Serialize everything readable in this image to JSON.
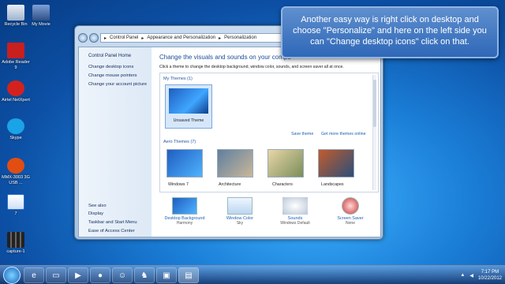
{
  "desktop": {
    "icons": [
      {
        "label": "Recycle Bin",
        "icon": "recycle-bin-icon",
        "color": "#c9d6e6"
      },
      {
        "label": "My Movie",
        "icon": "movie-icon",
        "color": "#4a6fa8"
      },
      {
        "label": "Adobe Reader 9",
        "icon": "adobe-reader-icon",
        "color": "#c81f1f"
      },
      {
        "label": "Airtel NetXpert",
        "icon": "airtel-icon",
        "color": "#d3221e"
      },
      {
        "label": "Skype",
        "icon": "skype-icon",
        "color": "#1aa3e6"
      },
      {
        "label": "MMX-3003 3G USB ...",
        "icon": "mmx-icon",
        "color": "#e24d12"
      },
      {
        "label": "7",
        "icon": "document-icon",
        "color": "#2d6bd0"
      },
      {
        "label": "capture-1",
        "icon": "capture-icon",
        "color": "#2a2a2a"
      }
    ]
  },
  "window": {
    "breadcrumb": [
      "Control Panel",
      "Appearance and Personalization",
      "Personalization"
    ],
    "leftnav": {
      "home": "Control Panel Home",
      "links": [
        "Change desktop icons",
        "Change mouse pointers",
        "Change your account picture"
      ],
      "see_also_title": "See also",
      "see_also": [
        "Display",
        "Taskbar and Start Menu",
        "Ease of Access Center"
      ]
    },
    "heading": "Change the visuals and sounds on your compu",
    "description": "Click a theme to change the desktop background, window color, sounds, and screen saver all at once.",
    "my_themes": {
      "title": "My Themes (1)",
      "items": [
        "Unsaved Theme"
      ],
      "save_link": "Save theme",
      "more_link": "Get more themes online"
    },
    "aero_themes": {
      "title": "Aero Themes (7)",
      "items": [
        "Windows 7",
        "Architecture",
        "Characters",
        "Landscapes"
      ]
    },
    "options": [
      {
        "label": "Desktop Background",
        "value": "Harmony",
        "icon": "desktop-background-icon"
      },
      {
        "label": "Window Color",
        "value": "Sky",
        "icon": "window-color-icon"
      },
      {
        "label": "Sounds",
        "value": "Windows Default",
        "icon": "sounds-icon"
      },
      {
        "label": "Screen Saver",
        "value": "None",
        "icon": "screen-saver-icon"
      }
    ]
  },
  "callout": {
    "text": "Another easy way is right click on desktop and choose \"Personalize\" and here on the left side you can \"Change desktop icons\" click on that."
  },
  "taskbar": {
    "items": [
      "ie-icon",
      "explorer-icon",
      "media-player-icon",
      "firefox-icon",
      "messenger-icon",
      "game-icon",
      "image-icon",
      "control-panel-icon"
    ],
    "time": "7:17 PM",
    "date": "10/22/2012"
  }
}
